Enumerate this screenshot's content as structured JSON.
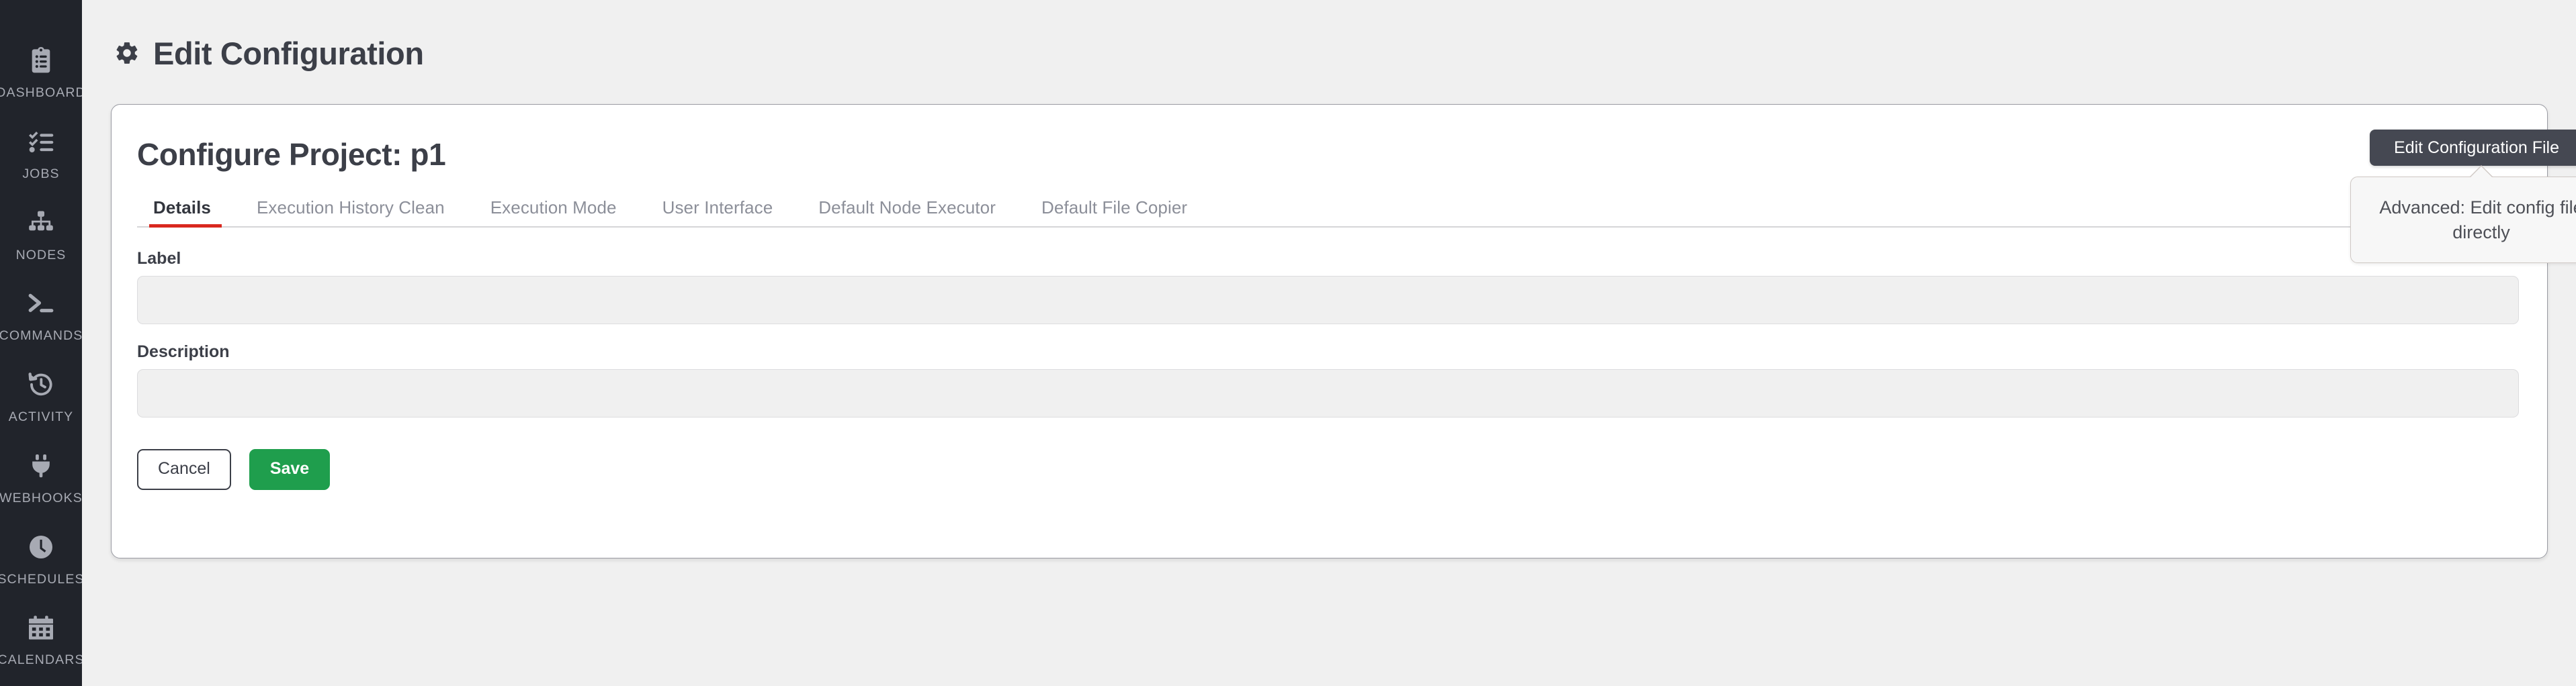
{
  "sidebar": {
    "items": [
      {
        "label": "DASHBOARD",
        "icon": "clipboard-list-icon"
      },
      {
        "label": "JOBS",
        "icon": "checklist-icon"
      },
      {
        "label": "NODES",
        "icon": "sitemap-icon"
      },
      {
        "label": "COMMANDS",
        "icon": "terminal-prompt-icon"
      },
      {
        "label": "ACTIVITY",
        "icon": "history-clock-icon"
      },
      {
        "label": "WEBHOOKS",
        "icon": "plug-icon"
      },
      {
        "label": "SCHEDULES",
        "icon": "clock-icon"
      },
      {
        "label": "CALENDARS",
        "icon": "calendar-icon"
      }
    ]
  },
  "header": {
    "title": "Edit Configuration",
    "icon": "gear-icon"
  },
  "card": {
    "title": "Configure Project: p1",
    "tabs": [
      {
        "label": "Details",
        "active": true
      },
      {
        "label": "Execution History Clean",
        "active": false
      },
      {
        "label": "Execution Mode",
        "active": false
      },
      {
        "label": "User Interface",
        "active": false
      },
      {
        "label": "Default Node Executor",
        "active": false
      },
      {
        "label": "Default File Copier",
        "active": false
      }
    ],
    "fields": [
      {
        "label": "Label",
        "value": "",
        "placeholder": ""
      },
      {
        "label": "Description",
        "value": "",
        "placeholder": ""
      }
    ],
    "actions": {
      "cancel_label": "Cancel",
      "save_label": "Save"
    }
  },
  "edit_config": {
    "button_label": "Edit Configuration File",
    "tooltip_text": "Advanced: Edit config file directly"
  },
  "colors": {
    "accent_red": "#d9281f",
    "save_green": "#1f9e4d",
    "sidebar_bg": "#21242b",
    "page_bg": "#f0f0f0",
    "tooltip_dark": "#454852",
    "text_dark": "#3c3f48"
  }
}
